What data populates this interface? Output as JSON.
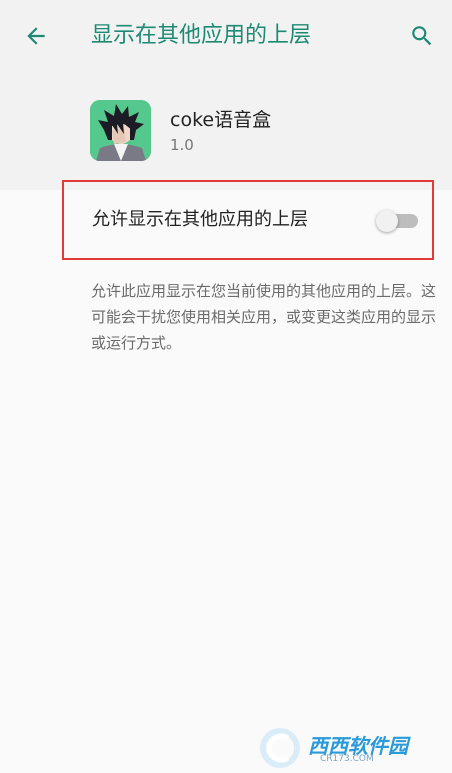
{
  "header": {
    "title": "显示在其他应用的上层",
    "back_icon": "arrow-left-icon",
    "search_icon": "search-icon",
    "accent_color": "#1e8a73"
  },
  "app": {
    "name": "coke语音盒",
    "version": "1.0",
    "icon": "app-avatar-icon"
  },
  "setting": {
    "label": "允许显示在其他应用的上层",
    "toggle_state": "off",
    "highlight_color": "#e53935"
  },
  "description": "允许此应用显示在您当前使用的其他应用的上层。这可能会干扰您使用相关应用，或变更这类应用的显示或运行方式。",
  "watermark": {
    "text": "西西软件园",
    "sub": "CR173.COM"
  }
}
